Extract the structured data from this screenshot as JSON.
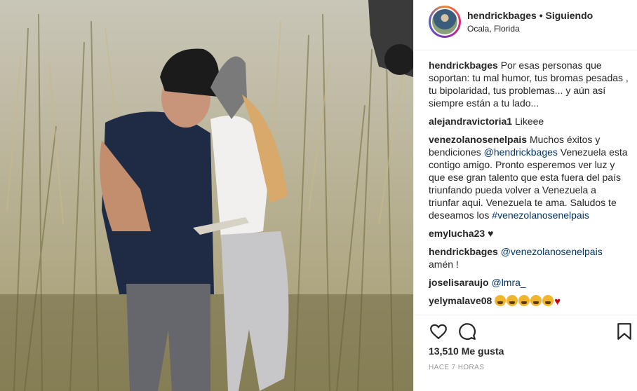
{
  "post": {
    "username": "hendrickbages",
    "separator": "•",
    "follow_status": "Siguiendo",
    "location": "Ocala, Florida"
  },
  "comments": [
    {
      "user": "hendrickbages",
      "text": "Por esas personas que soportan: tu mal humor, tus bromas pesadas , tu bipolaridad, tus problemas... y aún así siempre están a tu lado..."
    },
    {
      "user": "alejandravictoria1",
      "text": "Likeee"
    },
    {
      "user": "venezolanosenelpais",
      "text_before": "Muchos éxitos y bendiciones ",
      "mention": "@hendrickbages",
      "text_after": " Venezuela esta contigo amigo. Pronto esperemos ver luz y que ese gran talento que esta fuera del país triunfando pueda volver a Venezuela a triunfar aqui. Venezuela te ama. Saludos te deseamos los ",
      "hashtag": "#venezolanosenelpais"
    },
    {
      "user": "emylucha23",
      "text": "♥"
    },
    {
      "user": "hendrickbages",
      "mention": "@venezolanosenelpais",
      "text_after": "amén !"
    },
    {
      "user": "joselisaraujo",
      "mention": "@lmra_"
    },
    {
      "user": "yelymalave08",
      "emoji_count": 5,
      "heart": "♥"
    }
  ],
  "actions": {
    "like_icon": "heart-outline-icon",
    "comment_icon": "comment-bubble-icon",
    "save_icon": "bookmark-icon"
  },
  "likes_text": "13,510 Me gusta",
  "timestamp": "HACE 7 HORAS",
  "colors": {
    "link": "#003569",
    "heart": "#d0021b"
  }
}
